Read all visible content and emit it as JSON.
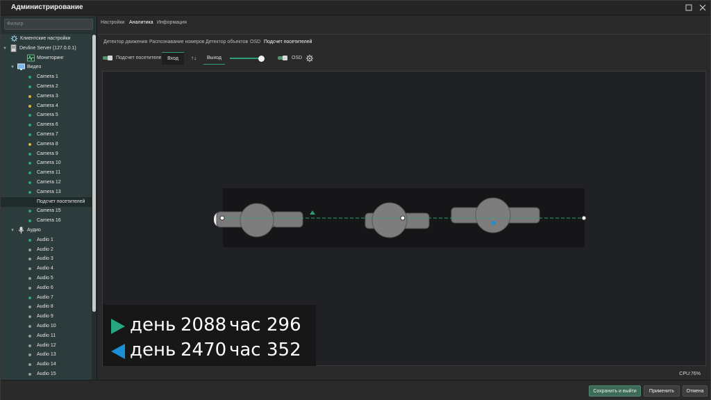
{
  "window": {
    "title": "Администрирование"
  },
  "sidebar": {
    "filter_placeholder": "Фильтр",
    "items": [
      {
        "label": "Клиентские настройки",
        "icon": "gear-icon",
        "level": 1
      },
      {
        "label": "Devline Server (127.0.0.1)",
        "icon": "server-icon",
        "level": 0,
        "expand": true
      },
      {
        "label": "Мониторинг",
        "icon": "monitoring-icon",
        "level": 2
      },
      {
        "label": "Видео",
        "icon": "monitor-icon",
        "level": 1,
        "expand": true
      },
      {
        "label": "Camera 1",
        "dot": "#27a882",
        "level": 3
      },
      {
        "label": "Camera 2",
        "dot": "#27a882",
        "level": 3
      },
      {
        "label": "Camera 3",
        "dot": "#e0b43a",
        "level": 3
      },
      {
        "label": "Camera 4",
        "dot": "#e0b43a",
        "level": 3
      },
      {
        "label": "Camera 5",
        "dot": "#27a882",
        "level": 3
      },
      {
        "label": "Camera 6",
        "dot": "#27a882",
        "level": 3
      },
      {
        "label": "Camera 7",
        "dot": "#27a882",
        "level": 3
      },
      {
        "label": "Camera 8",
        "dot": "#e0b43a",
        "level": 3
      },
      {
        "label": "Camera 9",
        "dot": "#27a882",
        "level": 3
      },
      {
        "label": "Camera 10",
        "dot": "#27a882",
        "level": 3
      },
      {
        "label": "Camera 11",
        "dot": "#27a882",
        "level": 3
      },
      {
        "label": "Camera 12",
        "dot": "#27a882",
        "level": 3
      },
      {
        "label": "Camera 13",
        "dot": "#27a882",
        "level": 3
      },
      {
        "label": "Подсчет посетителей",
        "dot": "",
        "level": 3,
        "selected": true
      },
      {
        "label": "Camera 15",
        "dot": "#27a882",
        "level": 3
      },
      {
        "label": "Camera 16",
        "dot": "#27a882",
        "level": 3
      },
      {
        "label": "Аудио",
        "icon": "microphone-icon",
        "level": 1,
        "expand": true
      },
      {
        "label": "Audio 1",
        "dot": "#27a882",
        "level": 3
      },
      {
        "label": "Audio 2",
        "dot": "#9a9a9a",
        "level": 3
      },
      {
        "label": "Audio 3",
        "dot": "#9a9a9a",
        "level": 3
      },
      {
        "label": "Audio 4",
        "dot": "#9a9a9a",
        "level": 3
      },
      {
        "label": "Audio 5",
        "dot": "#9a9a9a",
        "level": 3
      },
      {
        "label": "Audio 6",
        "dot": "#9a9a9a",
        "level": 3
      },
      {
        "label": "Audio 7",
        "dot": "#27a882",
        "level": 3
      },
      {
        "label": "Audio 8",
        "dot": "#9a9a9a",
        "level": 3
      },
      {
        "label": "Audio 9",
        "dot": "#9a9a9a",
        "level": 3
      },
      {
        "label": "Audio 10",
        "dot": "#9a9a9a",
        "level": 3
      },
      {
        "label": "Audio 11",
        "dot": "#9a9a9a",
        "level": 3
      },
      {
        "label": "Audio 12",
        "dot": "#9a9a9a",
        "level": 3
      },
      {
        "label": "Audio 13",
        "dot": "#9a9a9a",
        "level": 3
      },
      {
        "label": "Audio 14",
        "dot": "#9a9a9a",
        "level": 3
      },
      {
        "label": "Audio 15",
        "dot": "#9a9a9a",
        "level": 3
      }
    ]
  },
  "tabs": {
    "main": [
      "Настройки",
      "Аналитика",
      "Информация"
    ],
    "main_active": "Аналитика",
    "sub": [
      "Детектор движения",
      "Распознавание номеров",
      "Детектор объектов",
      "OSD",
      "Подсчет посетителей"
    ],
    "sub_active": "Подсчет посетителей"
  },
  "toolbar": {
    "counter_checkbox": "Подсчет посетителей",
    "entry_button": "Вход",
    "swap_symbol": "↑↓",
    "exit_button": "Выход",
    "osd_checkbox": "OSD",
    "slider_value": 0.85
  },
  "counters": {
    "in": {
      "day_label": "день",
      "day_value": "2088",
      "hour_label": "час",
      "hour_value": "296",
      "color": "#27a882"
    },
    "out": {
      "day_label": "день",
      "day_value": "2470",
      "hour_label": "час",
      "hour_value": "352",
      "color": "#1a8fd6"
    }
  },
  "status": {
    "cpu": "CPU:76%"
  },
  "footer": {
    "save_exit": "Сохранить и выйти",
    "apply": "Применить",
    "cancel": "Отмена"
  },
  "colors": {
    "accent": "#2e9e77",
    "primary_button": "#3d6a57"
  }
}
